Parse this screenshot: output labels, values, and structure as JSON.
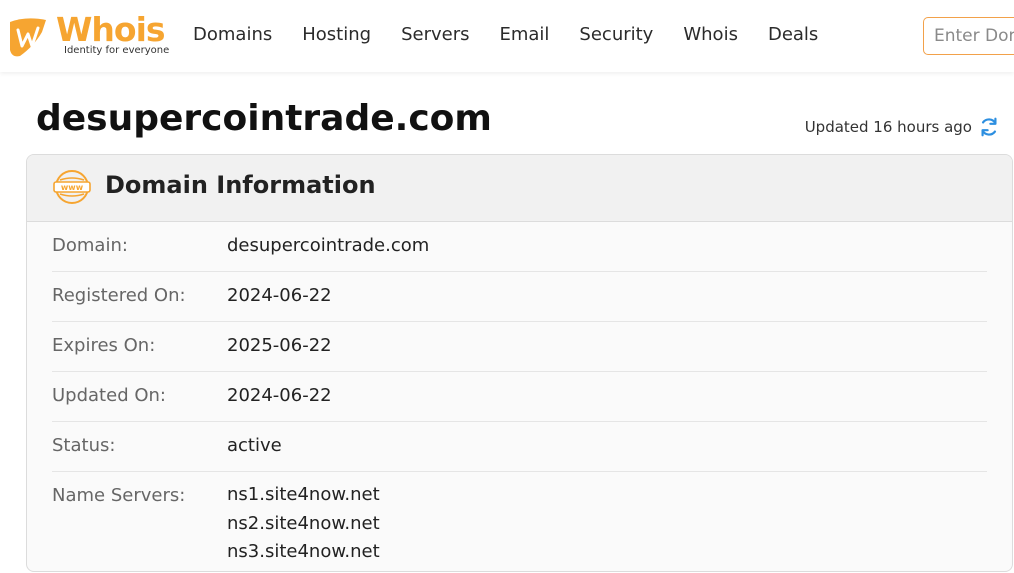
{
  "header": {
    "logo_text": "Whois",
    "logo_tagline": "Identity for everyone",
    "nav": [
      "Domains",
      "Hosting",
      "Servers",
      "Email",
      "Security",
      "Whois",
      "Deals"
    ],
    "search_placeholder": "Enter Domain"
  },
  "page": {
    "title": "desupercointrade.com",
    "updated_text": "Updated 16 hours ago"
  },
  "domain_info": {
    "heading": "Domain Information",
    "icon": "www-icon",
    "rows": [
      {
        "label": "Domain:",
        "value": "desupercointrade.com"
      },
      {
        "label": "Registered On:",
        "value": "2024-06-22"
      },
      {
        "label": "Expires On:",
        "value": "2025-06-22"
      },
      {
        "label": "Updated On:",
        "value": "2024-06-22"
      },
      {
        "label": "Status:",
        "value": "active"
      }
    ],
    "name_servers_label": "Name Servers:",
    "name_servers": [
      "ns1.site4now.net",
      "ns2.site4now.net",
      "ns3.site4now.net"
    ]
  },
  "colors": {
    "brand": "#f6a531",
    "refresh": "#2d8fe0"
  }
}
